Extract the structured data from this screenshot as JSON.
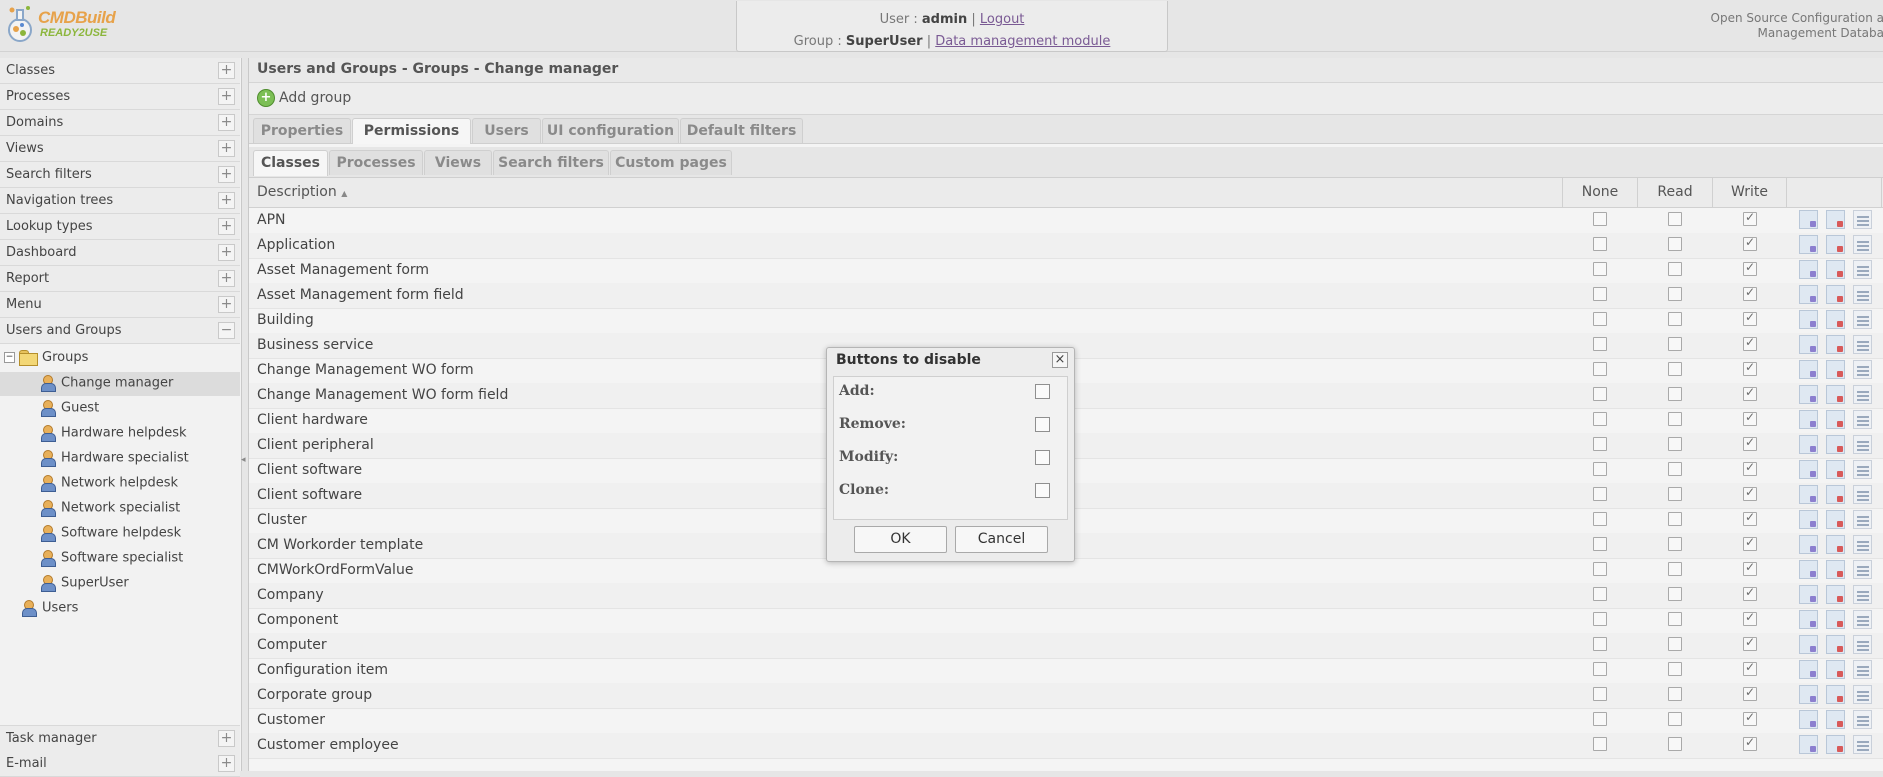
{
  "header": {
    "logo_text": "CMDBuild",
    "logo_sub": "READY2USE",
    "user_label": "User",
    "user_name": "admin",
    "logout": "Logout",
    "group_label": "Group",
    "group_name": "SuperUser",
    "module_link": "Data management module",
    "oss_line1": "Open Source Configuration a",
    "oss_line2": "Management Databa"
  },
  "sidebar": {
    "items": [
      {
        "label": "Classes",
        "toggle": "+"
      },
      {
        "label": "Processes",
        "toggle": "+"
      },
      {
        "label": "Domains",
        "toggle": "+"
      },
      {
        "label": "Views",
        "toggle": "+"
      },
      {
        "label": "Search filters",
        "toggle": "+"
      },
      {
        "label": "Navigation trees",
        "toggle": "+"
      },
      {
        "label": "Lookup types",
        "toggle": "+"
      },
      {
        "label": "Dashboard",
        "toggle": "+"
      },
      {
        "label": "Report",
        "toggle": "+"
      },
      {
        "label": "Menu",
        "toggle": "+"
      },
      {
        "label": "Users and Groups",
        "toggle": "−"
      }
    ],
    "tree": {
      "groups_label": "Groups",
      "groups": [
        "Change manager",
        "Guest",
        "Hardware helpdesk",
        "Hardware specialist",
        "Network helpdesk",
        "Network specialist",
        "Software helpdesk",
        "Software specialist",
        "SuperUser"
      ],
      "users_label": "Users"
    },
    "bottom_items": [
      {
        "label": "Task manager",
        "toggle": "+"
      },
      {
        "label": "E-mail",
        "toggle": "+"
      }
    ]
  },
  "main": {
    "title": "Users and Groups - Groups - Change manager",
    "add_group": "Add group",
    "tabs": [
      "Properties",
      "Permissions",
      "Users",
      "UI configuration",
      "Default filters"
    ],
    "subtabs": [
      "Classes",
      "Processes",
      "Views",
      "Search filters",
      "Custom pages"
    ],
    "grid": {
      "columns": {
        "description": "Description",
        "none": "None",
        "read": "Read",
        "write": "Write"
      },
      "sort_indicator": "▲",
      "rows": [
        "APN",
        "Application",
        "Asset Management form",
        "Asset Management form field",
        "Building",
        "Business service",
        "Change Management WO form",
        "Change Management WO form field",
        "Client hardware",
        "Client peripheral",
        "Client software",
        "Client software",
        "Cluster",
        "CM Workorder template",
        "CMWorkOrdFormValue",
        "Company",
        "Component",
        "Computer",
        "Configuration item",
        "Corporate group",
        "Customer",
        "Customer employee"
      ]
    }
  },
  "modal": {
    "title": "Buttons to disable",
    "close": "×",
    "options": [
      "Add:",
      "Remove:",
      "Modify:",
      "Clone:"
    ],
    "ok": "OK",
    "cancel": "Cancel"
  }
}
